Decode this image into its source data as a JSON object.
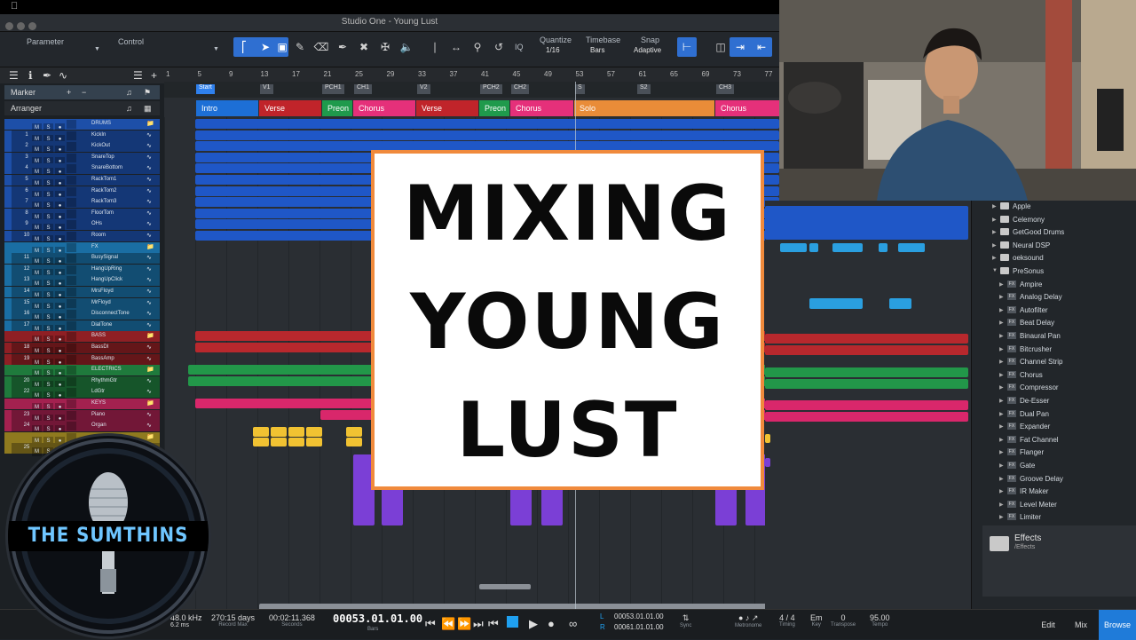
{
  "window": {
    "title": "Studio One - Young Lust"
  },
  "toolbar": {
    "parameter_label": "Parameter",
    "control_label": "Control",
    "iq_label": "IQ",
    "quantize_label": "Quantize",
    "quantize_value": "1/16",
    "timebase_label": "Timebase",
    "timebase_value": "Bars",
    "snap_label": "Snap",
    "snap_value": "Adaptive"
  },
  "ruler": [
    "1",
    "5",
    "9",
    "13",
    "17",
    "21",
    "25",
    "29",
    "33",
    "37",
    "41",
    "45",
    "49",
    "53",
    "57",
    "61",
    "65",
    "69",
    "73",
    "77"
  ],
  "left_panel": {
    "marker_label": "Marker",
    "arranger_label": "Arranger"
  },
  "markers": [
    "Start",
    "V1",
    "PCH1",
    "CH1",
    "V2",
    "PCH2",
    "CH2",
    "S",
    "S2",
    "CH3"
  ],
  "sections": [
    {
      "label": "Intro",
      "color": "#1d6fd6"
    },
    {
      "label": "Verse",
      "color": "#c0242a"
    },
    {
      "label": "Preon",
      "color": "#1f9a4c"
    },
    {
      "label": "Chorus",
      "color": "#e5307a"
    },
    {
      "label": "Verse",
      "color": "#c0242a"
    },
    {
      "label": "Preon",
      "color": "#1f9a4c"
    },
    {
      "label": "Chorus",
      "color": "#e5307a"
    },
    {
      "label": "Solo",
      "color": "#e98c38"
    },
    {
      "label": "Chorus",
      "color": "#e5307a"
    }
  ],
  "tracks": [
    {
      "num": "",
      "name": "DRUMS",
      "folder": true,
      "color": "#1d4fa8"
    },
    {
      "num": "1",
      "name": "KickIn",
      "color": "#1d4fa8"
    },
    {
      "num": "2",
      "name": "KickOut",
      "color": "#1d4fa8"
    },
    {
      "num": "3",
      "name": "SnareTop",
      "color": "#1d4fa8"
    },
    {
      "num": "4",
      "name": "SnareBottom",
      "color": "#1d4fa8"
    },
    {
      "num": "5",
      "name": "RackTom1",
      "color": "#1d4fa8"
    },
    {
      "num": "6",
      "name": "RackTom2",
      "color": "#1d4fa8"
    },
    {
      "num": "7",
      "name": "RackTom3",
      "color": "#1d4fa8"
    },
    {
      "num": "8",
      "name": "FloorTom",
      "color": "#1d4fa8"
    },
    {
      "num": "9",
      "name": "OHs",
      "color": "#1d4fa8"
    },
    {
      "num": "10",
      "name": "Room",
      "color": "#1d4fa8"
    },
    {
      "num": "",
      "name": "FX",
      "folder": true,
      "color": "#1a6ea3"
    },
    {
      "num": "11",
      "name": "BusySignal",
      "color": "#1a6ea3"
    },
    {
      "num": "12",
      "name": "HangUpRing",
      "color": "#1a6ea3"
    },
    {
      "num": "13",
      "name": "HangUpClick",
      "color": "#1a6ea3"
    },
    {
      "num": "14",
      "name": "MrsFloyd",
      "color": "#1a6ea3"
    },
    {
      "num": "15",
      "name": "MrFloyd",
      "color": "#1a6ea3"
    },
    {
      "num": "16",
      "name": "DisconnectTone",
      "color": "#1a6ea3"
    },
    {
      "num": "17",
      "name": "DialTone",
      "color": "#1a6ea3"
    },
    {
      "num": "",
      "name": "BASS",
      "folder": true,
      "color": "#8f1f24"
    },
    {
      "num": "18",
      "name": "BassDI",
      "color": "#8f1f24"
    },
    {
      "num": "19",
      "name": "BassAmp",
      "color": "#8f1f24"
    },
    {
      "num": "",
      "name": "ELECTRICS",
      "folder": true,
      "color": "#1f7a3c"
    },
    {
      "num": "20",
      "name": "RhythmGtr",
      "color": "#1f7a3c"
    },
    {
      "num": "22",
      "name": "LdGtr",
      "color": "#1f7a3c"
    },
    {
      "num": "",
      "name": "KEYS",
      "folder": true,
      "color": "#a3214f"
    },
    {
      "num": "23",
      "name": "Piano",
      "color": "#a3214f"
    },
    {
      "num": "24",
      "name": "Organ",
      "color": "#a3214f"
    },
    {
      "num": "",
      "name": "",
      "folder": true,
      "color": "#8f7a1f"
    },
    {
      "num": "25",
      "name": "",
      "color": "#8f7a1f"
    }
  ],
  "browser": {
    "items": [
      {
        "label": "Apple",
        "type": "folder"
      },
      {
        "label": "Celemony",
        "type": "folder"
      },
      {
        "label": "GetGood Drums",
        "type": "folder"
      },
      {
        "label": "Neural DSP",
        "type": "folder"
      },
      {
        "label": "oeksound",
        "type": "folder"
      },
      {
        "label": "PreSonus",
        "type": "folder-open"
      },
      {
        "label": "Ampire",
        "type": "fx"
      },
      {
        "label": "Analog Delay",
        "type": "fx"
      },
      {
        "label": "Autofilter",
        "type": "fx"
      },
      {
        "label": "Beat Delay",
        "type": "fx"
      },
      {
        "label": "Binaural Pan",
        "type": "fx"
      },
      {
        "label": "Bitcrusher",
        "type": "fx"
      },
      {
        "label": "Channel Strip",
        "type": "fx"
      },
      {
        "label": "Chorus",
        "type": "fx"
      },
      {
        "label": "Compressor",
        "type": "fx"
      },
      {
        "label": "De-Esser",
        "type": "fx"
      },
      {
        "label": "Dual Pan",
        "type": "fx"
      },
      {
        "label": "Expander",
        "type": "fx"
      },
      {
        "label": "Fat Channel",
        "type": "fx"
      },
      {
        "label": "Flanger",
        "type": "fx"
      },
      {
        "label": "Gate",
        "type": "fx"
      },
      {
        "label": "Groove Delay",
        "type": "fx"
      },
      {
        "label": "IR Maker",
        "type": "fx"
      },
      {
        "label": "Level Meter",
        "type": "fx"
      },
      {
        "label": "Limiter",
        "type": "fx"
      }
    ],
    "footer_title": "Effects",
    "footer_path": "/Effects"
  },
  "transport": {
    "sample_rate": "48.0 kHz",
    "latency": "6.2 ms",
    "record_days": "270:15 days",
    "record_label": "Record Max",
    "seconds_value": "00:02:11.368",
    "seconds_label": "Seconds",
    "bars_value": "00053.01.01.00",
    "bars_label": "Bars",
    "loop_l": "00053.01.01.00",
    "loop_r": "00061.01.01.00",
    "sync_label": "Sync",
    "metronome_label": "Metronome",
    "timing_value": "4 / 4",
    "timing_label": "Timing",
    "key_value": "Em",
    "key_label": "Key",
    "transpose_value": "0",
    "transpose_label": "Transpose",
    "tempo_value": "95.00",
    "tempo_label": "Tempo",
    "tabs": [
      "Edit",
      "Mix",
      "Browse"
    ]
  },
  "overlay": {
    "line1": "MIXING",
    "line2": "YOUNG",
    "line3": "LUST"
  },
  "logo": {
    "text": "THE SUMTHINS"
  }
}
